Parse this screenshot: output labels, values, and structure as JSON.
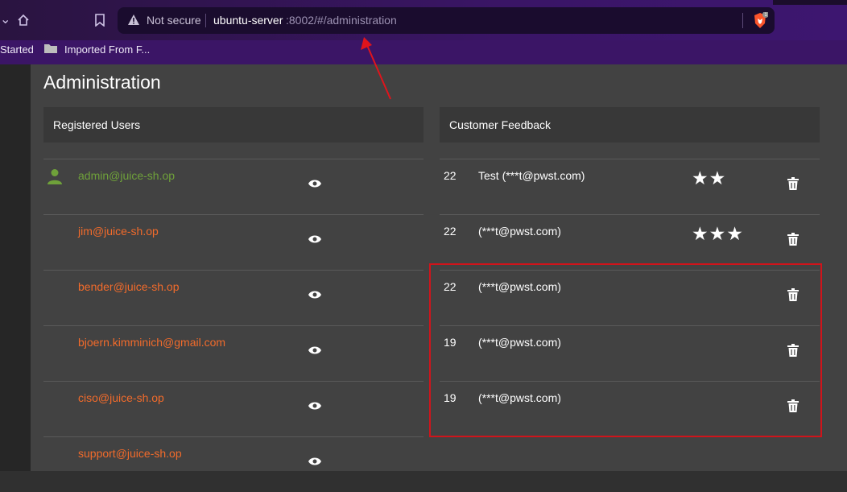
{
  "browser": {
    "not_secure": "Not secure",
    "url_host": "ubuntu-server",
    "url_path": ":8002/#/administration",
    "brave_badge": "1"
  },
  "bookmarks": [
    {
      "label": "Started"
    },
    {
      "label": "Imported From F..."
    }
  ],
  "page": {
    "title": "Administration",
    "users_header": "Registered Users",
    "feedback_header": "Customer Feedback"
  },
  "users": [
    {
      "email": "admin@juice-sh.op",
      "color": "#6fa13a",
      "admin": true
    },
    {
      "email": "jim@juice-sh.op",
      "color": "#f26b2b",
      "admin": false
    },
    {
      "email": "bender@juice-sh.op",
      "color": "#f26b2b",
      "admin": false
    },
    {
      "email": "bjoern.kimminich@gmail.com",
      "color": "#f26b2b",
      "admin": false
    },
    {
      "email": "ciso@juice-sh.op",
      "color": "#f26b2b",
      "admin": false
    },
    {
      "email": "support@juice-sh.op",
      "color": "#f26b2b",
      "admin": false
    }
  ],
  "feedback": [
    {
      "user_id": "22",
      "comment": "Test (***t@pwst.com)",
      "rating": 2
    },
    {
      "user_id": "22",
      "comment": "(***t@pwst.com)",
      "rating": 3
    },
    {
      "user_id": "22",
      "comment": "(***t@pwst.com)",
      "rating": 0
    },
    {
      "user_id": "19",
      "comment": "(***t@pwst.com)",
      "rating": 0
    },
    {
      "user_id": "19",
      "comment": "(***t@pwst.com)",
      "rating": 0
    }
  ],
  "colors": {
    "highlight": "#d0141b",
    "admin_email": "#6fa13a",
    "user_email": "#f26b2b"
  }
}
